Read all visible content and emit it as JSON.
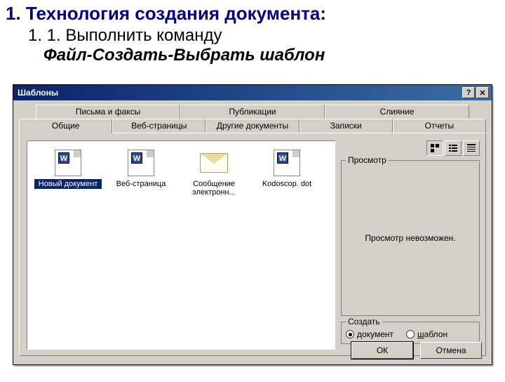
{
  "slide": {
    "heading": "1. Технология создания документа:",
    "sub1": "1. 1. Выполнить команду",
    "sub2": "Файл-Создать-Выбрать шаблон"
  },
  "dialog": {
    "title": "Шаблоны",
    "tabsBack": [
      "Письма и факсы",
      "Публикации",
      "Слияние"
    ],
    "tabsFront": [
      "Общие",
      "Веб-страницы",
      "Другие документы",
      "Записки",
      "Отчеты"
    ],
    "activeFrontTab": 0,
    "items": [
      {
        "label": "Новый документ",
        "type": "word",
        "selected": true
      },
      {
        "label": "Веб-страница",
        "type": "word",
        "selected": false
      },
      {
        "label": "Сообщение электронн...",
        "type": "mail",
        "selected": false
      },
      {
        "label": "Kodoscop. dot",
        "type": "word",
        "selected": false
      }
    ],
    "previewGroup": "Просмотр",
    "previewText": "Просмотр невозможен.",
    "createGroup": "Создать",
    "radioDoc": "документ",
    "radioDocHot": "д",
    "radioTpl": "шаблон",
    "radioTplHot": "ш",
    "ok": "ОК",
    "cancel": "Отмена"
  }
}
